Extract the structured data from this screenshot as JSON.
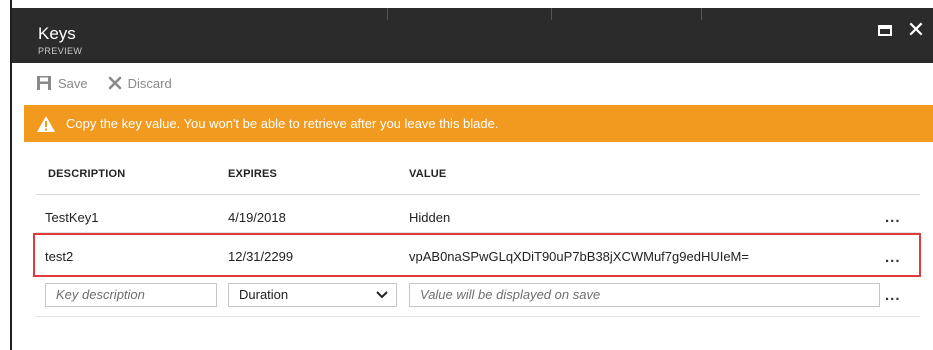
{
  "window": {
    "title": "Keys",
    "subtitle": "PREVIEW",
    "maximize_icon": "maximize-icon",
    "close_icon": "close-icon",
    "close_glyph": "✕"
  },
  "toolbar": {
    "save_label": "Save",
    "save_icon": "save-icon",
    "discard_label": "Discard",
    "discard_icon": "discard-icon"
  },
  "banner": {
    "icon": "warning-icon",
    "text": "Copy the key value. You won't be able to retrieve after you leave this blade.",
    "color": "#f29a1f"
  },
  "table": {
    "columns": [
      "DESCRIPTION",
      "EXPIRES",
      "VALUE"
    ],
    "rows": [
      {
        "description": "TestKey1",
        "expires": "4/19/2018",
        "value": "Hidden",
        "menu": "..."
      },
      {
        "description": "test2",
        "expires": "12/31/2299",
        "value": "vpAB0naSPwGLqXDiT90uP7bB38jXCWMuf7g9edHUIeM=",
        "menu": "..."
      }
    ],
    "highlight_color": "#e0393e"
  },
  "new_row": {
    "description_placeholder": "Key description",
    "duration_selected": "Duration",
    "value_placeholder": "Value will be displayed on save",
    "menu": "..."
  },
  "colors": {
    "titlebar": "#2b2b2b",
    "toolbar_text": "#8a8a8a"
  }
}
